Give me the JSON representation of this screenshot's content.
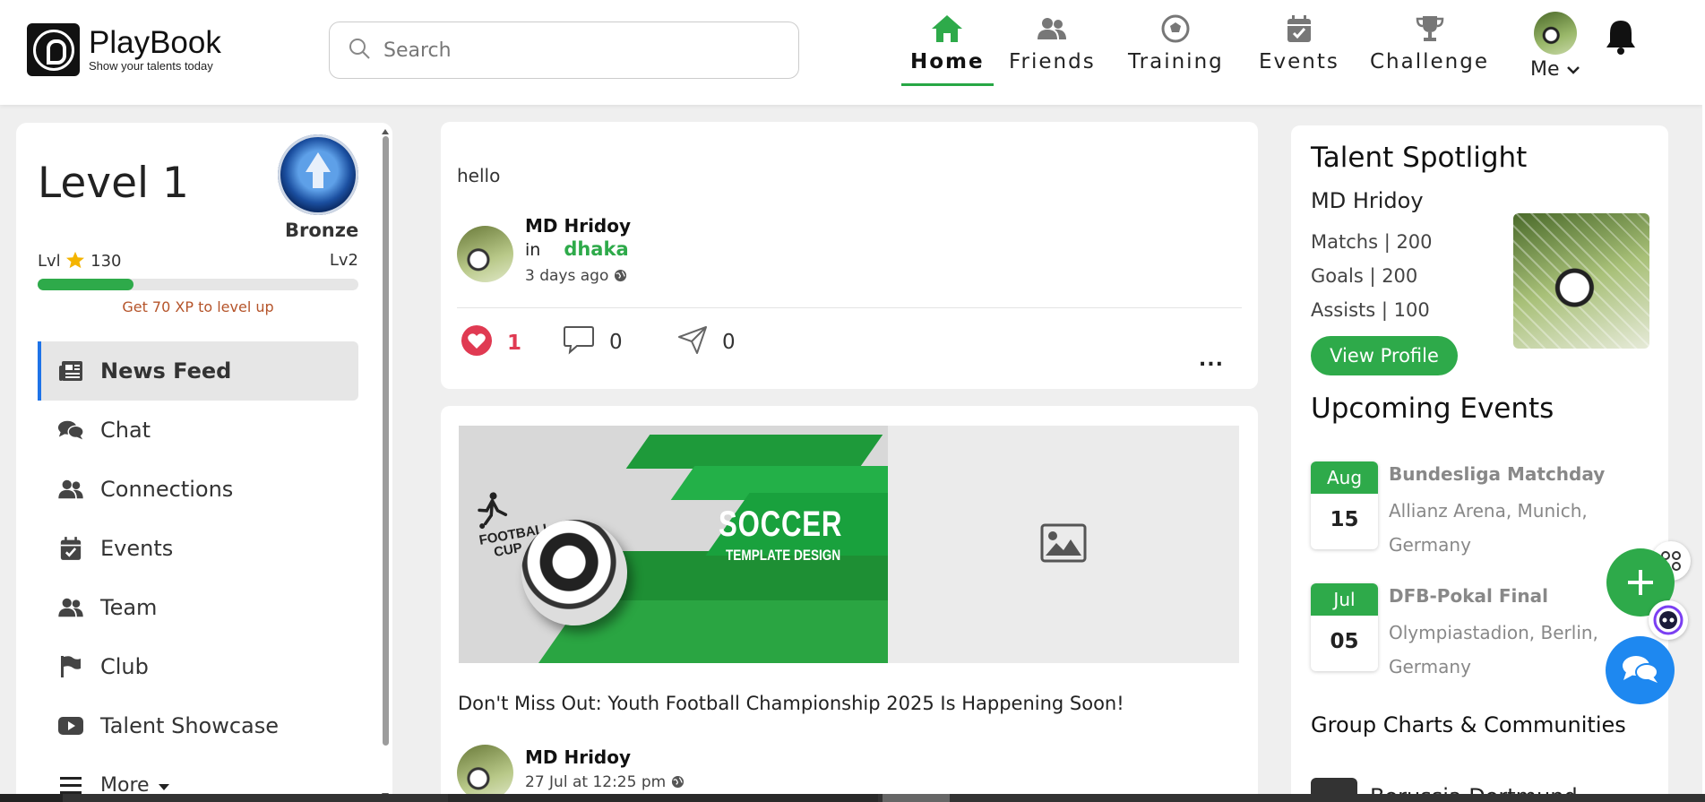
{
  "brand": {
    "name": "PlayBook",
    "tagline": "Show your talents today"
  },
  "search": {
    "placeholder": "Search"
  },
  "nav": [
    {
      "label": "Home",
      "icon": "home-icon",
      "active": true
    },
    {
      "label": "Friends",
      "icon": "friends-icon"
    },
    {
      "label": "Training",
      "icon": "football-icon"
    },
    {
      "label": "Events",
      "icon": "calendar-icon"
    },
    {
      "label": "Challenge",
      "icon": "trophy-icon"
    }
  ],
  "me": {
    "label": "Me"
  },
  "level": {
    "title": "Level 1",
    "rank": "Bronze",
    "current": "Lvl",
    "xp": "130",
    "next": "Lv2",
    "progress": 0.3,
    "note": "Get 70 XP to level up"
  },
  "menu": [
    {
      "label": "News Feed",
      "icon": "newspaper-icon",
      "active": true
    },
    {
      "label": "Chat",
      "icon": "chat-icon"
    },
    {
      "label": "Connections",
      "icon": "users-icon"
    },
    {
      "label": "Events",
      "icon": "calendar-icon"
    },
    {
      "label": "Team",
      "icon": "users-icon"
    },
    {
      "label": "Club",
      "icon": "flag-icon"
    },
    {
      "label": "Talent Showcase",
      "icon": "video-icon"
    },
    {
      "label": "More",
      "icon": "hamburger-icon"
    }
  ],
  "post1": {
    "text": "hello",
    "author": "MD Hridoy",
    "in": "in",
    "location": "dhaka",
    "time": "3 days ago",
    "likes": "1",
    "comments": "0",
    "shares": "0",
    "more": "..."
  },
  "post2": {
    "banner": {
      "brand": "FOOTBALL",
      "brand2": "CUP",
      "title": "SOCCER",
      "subtitle": "TEMPLATE DESIGN"
    },
    "headline": "Don't Miss Out: Youth Football Championship 2025 Is Happening Soon!",
    "author": "MD Hridoy",
    "time": "27 Jul at 12:25 pm"
  },
  "spotlight": {
    "title": "Talent Spotlight",
    "name": "MD Hridoy",
    "matches": "Matchs | 200",
    "goals": "Goals | 200",
    "assists": "Assists | 100",
    "button": "View Profile"
  },
  "events": {
    "title": "Upcoming Events",
    "items": [
      {
        "month": "Aug",
        "day": "15",
        "name": "Bundesliga Matchday",
        "place": "Allianz Arena, Munich, Germany"
      },
      {
        "month": "Jul",
        "day": "05",
        "name": "DFB-Pokal Final",
        "place": "Olympiastadion, Berlin, Germany"
      }
    ]
  },
  "groups": {
    "title": "Group Charts & Communities",
    "first": "Borussia Dortmund"
  },
  "colors": {
    "accent": "#2eaa4a",
    "link": "#1e73e8",
    "like": "#e03a52",
    "chat_fab": "#1e88f0"
  }
}
